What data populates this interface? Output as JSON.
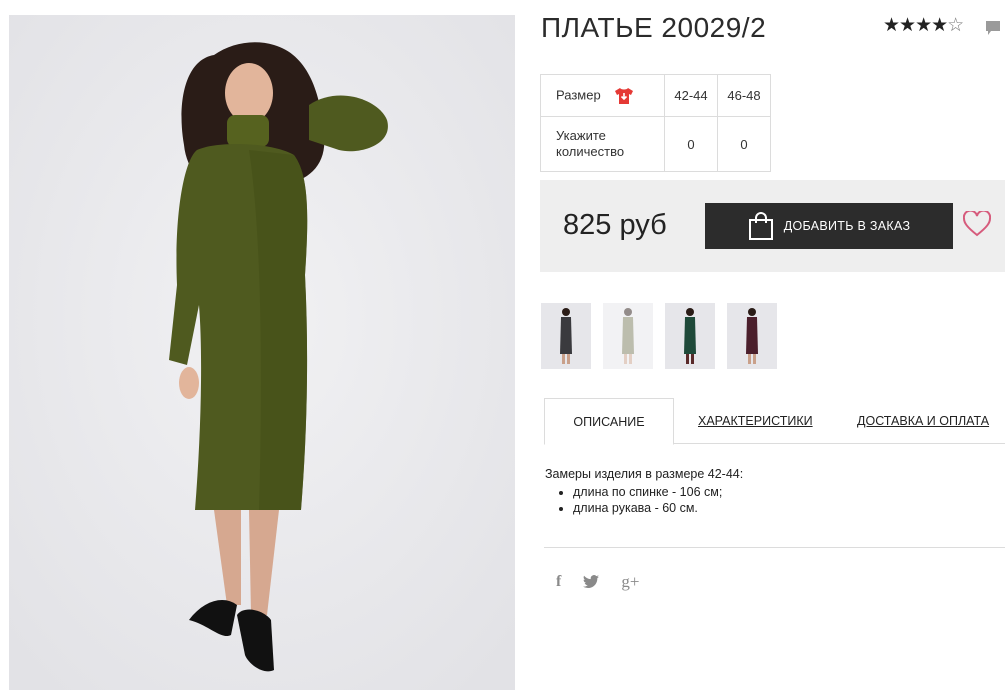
{
  "product": {
    "title": "ПЛАТЬЕ 20029/2",
    "rating_stars_filled": "★★★★",
    "rating_stars_empty": "☆",
    "rating_value": 4
  },
  "sizes": {
    "size_label": "Размер",
    "qty_label_line1": "Укажите",
    "qty_label_line2": "количество",
    "columns": [
      "42-44",
      "46-48"
    ],
    "quantities": [
      "0",
      "0"
    ]
  },
  "buy": {
    "price": "825 руб",
    "add_button": "ДОБАВИТЬ В ЗАКАЗ"
  },
  "thumbnails": [
    {
      "color": "#3a3a3e"
    },
    {
      "color": "#7b7d5e"
    },
    {
      "color": "#1f4a3a"
    },
    {
      "color": "#4b1f2c"
    }
  ],
  "tabs": {
    "description": "ОПИСАНИЕ",
    "specs": "ХАРАКТЕРИСТИКИ",
    "delivery": "ДОСТАВКА И ОПЛАТА"
  },
  "description": {
    "intro": "Замеры изделия в размере 42-44:",
    "items": [
      "длина по спинке - 106 см;",
      "длина рукава - 60 см."
    ]
  },
  "social": {
    "facebook": "f",
    "google_plus": "g+"
  },
  "colors": {
    "accent_red": "#e53935",
    "dress_olive": "#4f5a1f",
    "button_dark": "#2c2c2c"
  }
}
